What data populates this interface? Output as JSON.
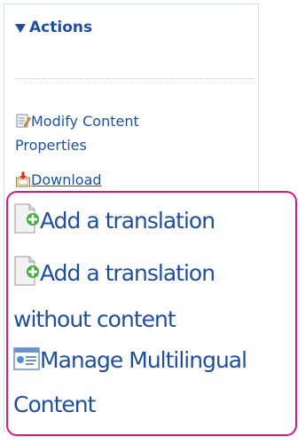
{
  "panel": {
    "title": "Actions"
  },
  "actions": {
    "modify_line1": "Modify Content",
    "modify_line2": "Properties",
    "download": "Download"
  },
  "magnified": {
    "add_translation": "Add a translation",
    "add_translation_no_content_line1": "Add a translation",
    "add_translation_no_content_line2": "without content",
    "manage_multilingual_line1": "Manage Multilingual",
    "manage_multilingual_line2": "Content"
  },
  "icons": {
    "collapse": "collapse-triangle-icon",
    "modify": "edit-document-icon",
    "download": "download-icon",
    "add_translation": "document-add-icon",
    "add_translation_no_content": "document-add-icon",
    "manage_multilingual": "multilingual-card-icon"
  },
  "colors": {
    "link": "#1f4f9c",
    "highlight_border": "#d81a7d",
    "panel_border": "#d6dee6"
  }
}
